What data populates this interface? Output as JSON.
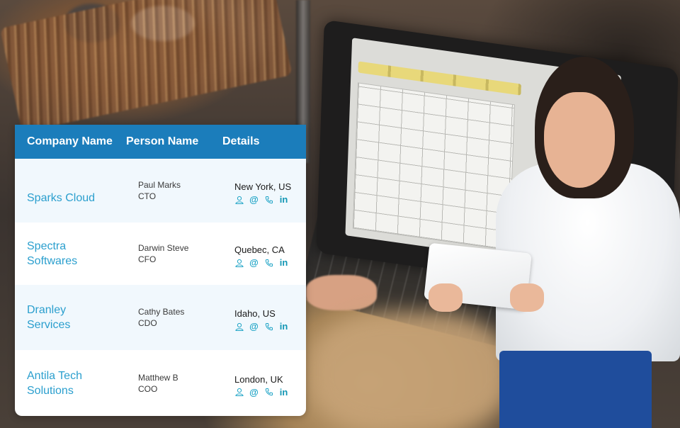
{
  "table": {
    "headers": {
      "company": "Company Name",
      "person": "Person Name",
      "details": "Details"
    },
    "rows": [
      {
        "company": "Sparks Cloud",
        "person": "Paul Marks",
        "role": "CTO",
        "location": "New York, US"
      },
      {
        "company": "Spectra Softwares",
        "person": "Darwin Steve",
        "role": "CFO",
        "location": "Quebec, CA"
      },
      {
        "company": "Dranley Services",
        "person": "Cathy Bates",
        "role": "CDO",
        "location": "Idaho, US"
      },
      {
        "company": "Antila Tech Solutions",
        "person": "Matthew B",
        "role": "COO",
        "location": "London, UK"
      }
    ],
    "detail_icons": [
      "user-icon",
      "email-at-icon",
      "phone-icon",
      "linkedin-icon"
    ],
    "icon_glyphs": {
      "email": "@",
      "linkedin": "in"
    }
  },
  "colors": {
    "header_bg": "#1b7dbb",
    "company_text": "#2b9fce",
    "icon_color": "#1fa4c6",
    "row_alt_bg": "#f1f8fd"
  }
}
